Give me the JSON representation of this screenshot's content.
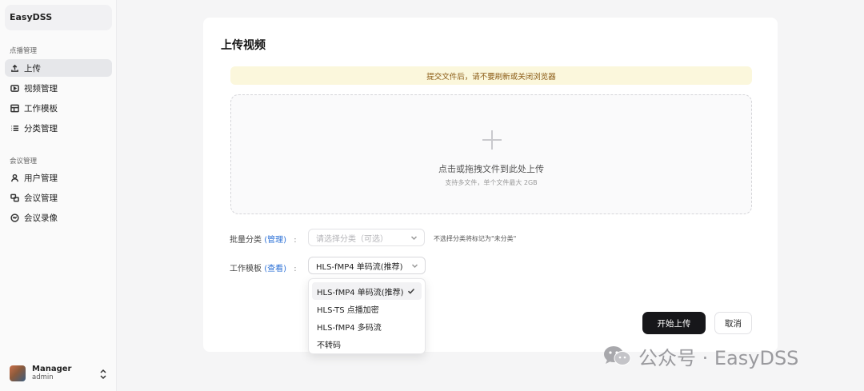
{
  "app": {
    "brand": "EasyDSS"
  },
  "sidebar": {
    "groups": [
      {
        "title": "点播管理",
        "items": [
          {
            "label": "上传",
            "icon": "upload-icon",
            "active": true
          },
          {
            "label": "视频管理",
            "icon": "video-icon"
          },
          {
            "label": "工作模板",
            "icon": "template-icon"
          },
          {
            "label": "分类管理",
            "icon": "list-icon"
          }
        ]
      },
      {
        "title": "会议管理",
        "items": [
          {
            "label": "用户管理",
            "icon": "user-icon"
          },
          {
            "label": "会议管理",
            "icon": "meeting-icon"
          },
          {
            "label": "会议录像",
            "icon": "recording-icon"
          }
        ]
      }
    ],
    "user": {
      "name": "Manager",
      "role": "admin",
      "switch_icon": "chevrons-up-down-icon"
    }
  },
  "main": {
    "title": "上传视频",
    "notice": "提交文件后，请不要刷新或关闭浏览器",
    "dropzone": {
      "icon": "plus-icon",
      "main_text": "点击或拖拽文件到此处上传",
      "sub_text": "支持多文件，单个文件最大 2GB"
    },
    "category": {
      "label": "批量分类",
      "link": "(管理)",
      "colon": ":",
      "placeholder": "请选择分类（可选）",
      "hint": "不选择分类将标记为\"未分类\""
    },
    "template": {
      "label": "工作模板",
      "link": "(查看)",
      "colon": ":",
      "value": "HLS-fMP4 单码流(推荐)",
      "options": [
        "HLS-fMP4 单码流(推荐)",
        "HLS-TS 点播加密",
        "HLS-fMP4 多码流",
        "不转码"
      ],
      "selected_index": 0
    },
    "buttons": {
      "start": "开始上传",
      "cancel": "取消"
    }
  },
  "watermark": {
    "text": "公众号 · EasyDSS",
    "icon": "wechat-icon"
  },
  "colors": {
    "accent_link": "#2a6fd6",
    "primary_button": "#17171a",
    "notice_bg": "#fbf7dc",
    "notice_text": "#8a5a14"
  }
}
